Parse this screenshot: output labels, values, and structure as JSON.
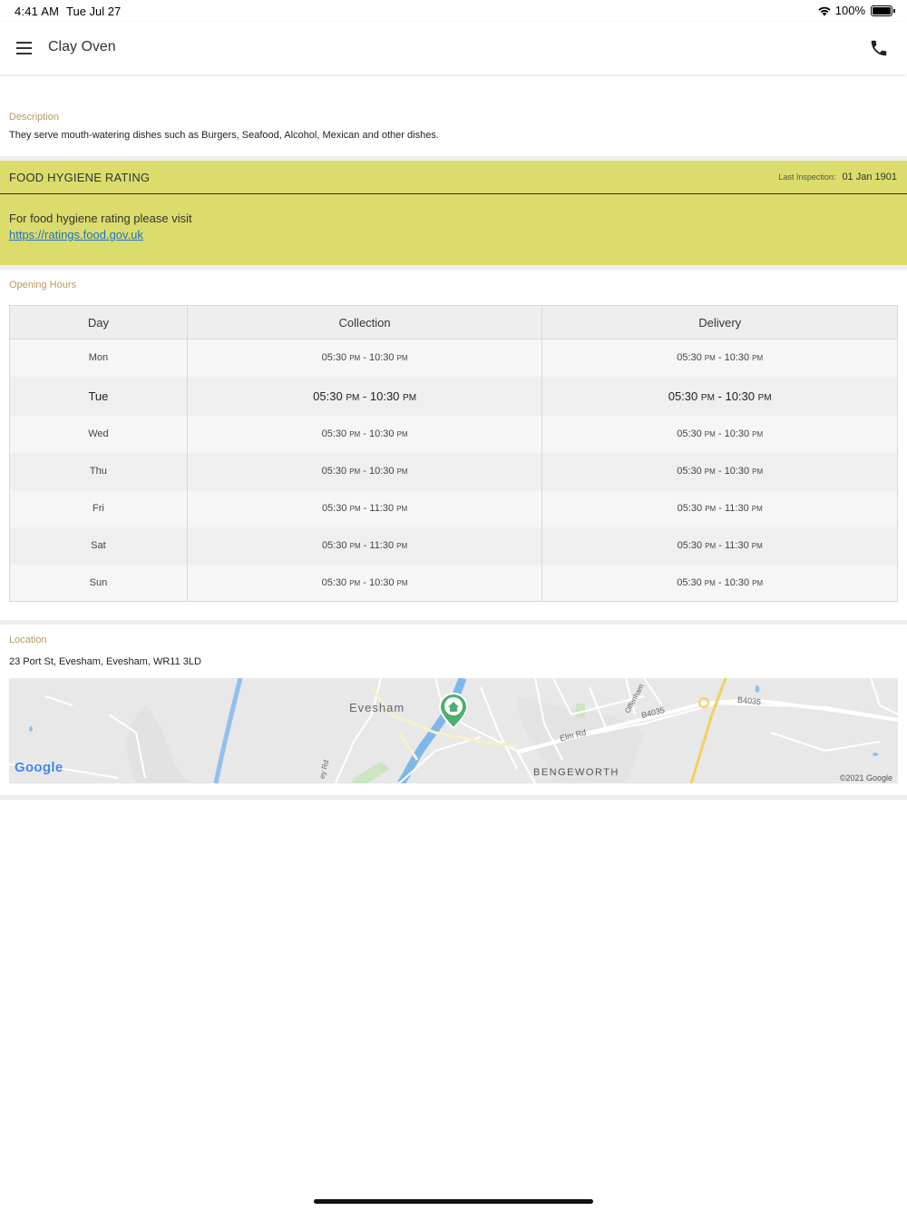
{
  "status_bar": {
    "time": "4:41 AM",
    "date": "Tue Jul 27",
    "battery": "100%"
  },
  "header": {
    "title": "Clay Oven",
    "menu_icon": "hamburger-menu-icon",
    "phone_icon": "phone-icon"
  },
  "description": {
    "label": "Description",
    "text": "They serve mouth-watering dishes such as Burgers, Seafood, Alcohol, Mexican and other dishes."
  },
  "hygiene": {
    "title": "FOOD HYGIENE RATING",
    "inspection_label": "Last Inspection:",
    "inspection_date": "01 Jan 1901",
    "prompt": "For food hygiene rating please visit",
    "link": "https://ratings.food.gov.uk",
    "bg_color": "#dcdc6c"
  },
  "hours": {
    "label": "Opening Hours",
    "headers": [
      "Day",
      "Collection",
      "Delivery"
    ],
    "am_pm": "PM",
    "rows": [
      {
        "day": "Mon",
        "col_open": "05:30",
        "col_close": "10:30",
        "del_open": "05:30",
        "del_close": "10:30"
      },
      {
        "day": "Tue",
        "col_open": "05:30",
        "col_close": "10:30",
        "del_open": "05:30",
        "del_close": "10:30"
      },
      {
        "day": "Wed",
        "col_open": "05:30",
        "col_close": "10:30",
        "del_open": "05:30",
        "del_close": "10:30"
      },
      {
        "day": "Thu",
        "col_open": "05:30",
        "col_close": "10:30",
        "del_open": "05:30",
        "del_close": "10:30"
      },
      {
        "day": "Fri",
        "col_open": "05:30",
        "col_close": "11:30",
        "del_open": "05:30",
        "del_close": "11:30"
      },
      {
        "day": "Sat",
        "col_open": "05:30",
        "col_close": "11:30",
        "del_open": "05:30",
        "del_close": "11:30"
      },
      {
        "day": "Sun",
        "col_open": "05:30",
        "col_close": "10:30",
        "del_open": "05:30",
        "del_close": "10:30"
      }
    ]
  },
  "location": {
    "label": "Location",
    "address": "23 Port St, Evesham, Evesham, WR11 3LD",
    "map": {
      "town_label": "Evesham",
      "district_label": "BENGEWORTH",
      "roads": [
        "Elm Rd",
        "B4035",
        "B4035",
        "Offenham",
        "ey Rd"
      ],
      "copyright": "©2021 Google",
      "logo": "Google",
      "marker_icon": "home-marker-icon"
    }
  }
}
